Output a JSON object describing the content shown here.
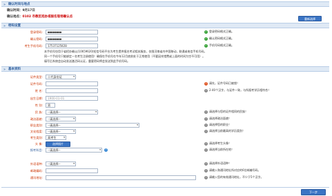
{
  "sections": {
    "confirm": "确认时间与地点",
    "password": "密码设置",
    "basic": "基本资料"
  },
  "confirm": {
    "time_label": "确认时间：",
    "time_value": "9月17日",
    "place_label": "确认地点：",
    "place_value": "0102  市教区招办或报名现场确认点",
    "reselect": "重新选择"
  },
  "password": {
    "login_label": "登录密码:",
    "login_value": "●●●●●●●●",
    "login_hint": "登录密码格式正确。",
    "confirm_label": "确认密码:",
    "confirm_value": "●●●●●●●●",
    "confirm_hint": "确认密码格式正确。",
    "phone_label": "考生手机号码:",
    "phone_value": "17537125820",
    "phone_hint": "手机号码格式正确。",
    "notice": [
      "本手机号仅用于省招办确认(10659620)短信号码平台为考生提供报名考试相关服务，仅限河南省内中国移动，联通或电信手机号码。",
      "同一个手机号只能绑定一名考生注册使用！确保在手机号在今年12月底前处于正常使用（不要因充错费或上面的时间为空不可用）。",
      "填写后系统会自动发送激活码认证，重要密码将会发送到此手机号码。"
    ]
  },
  "basic": {
    "id_type_label": "证件类型:",
    "id_type_value": "二代身份证",
    "id_no_label": "证件号码:",
    "id_no_value": "",
    "id_no_hint": "请先，证件号码已被锁！",
    "name_label": "姓    名:",
    "name_value": "",
    "name_hint": "2-40个汉字，与证件一致，与所报考学历相符合！",
    "birth_label": "出生日期:",
    "birth_value": "1900-01-01",
    "gender_label": "性    别:",
    "gender_value": "男",
    "ethnic_label": "民    族:",
    "ethnic_value": "--请选择--",
    "ethnic_hint": "请选择与您的证件相同的民族！",
    "politic_label": "政治面貌:",
    "politic_value": "--请选择--",
    "politic_hint": "请选择政治面貌！",
    "job_label": "职业类别:",
    "job_value": "--请选择--",
    "job_hint": "请选择您的职业！",
    "edu_label": "文化程度:",
    "edu_value": "--请选择--",
    "edu_hint": "请选择当前最高的学历类别！",
    "student_type_label": "考生类别:",
    "student_type_value": "高考生",
    "photo_label": "头    像:",
    "photo_button": "选择照片",
    "photo_hint": "请选择考生头像！",
    "checkin_label": "报考科目:",
    "checkin_value": "--请选择--",
    "checkin_hint": "请选择当前所在地！",
    "lang_label": "外语语种:",
    "lang_value": "--请选择--",
    "lang_hint": "请选择外语语种！",
    "postcode_label": "邮政编码:",
    "postcode_value": "",
    "postcode_hint": "请输入和通讯地址所对应的6位邮编号码。",
    "address_label": "通讯地址:",
    "address_value": "",
    "address_hint": "请输入您的有效通讯地址，不少于5个汉字。"
  },
  "next_button": "下一步",
  "colors": {
    "header_bg": "#dfe9f5",
    "accent": "#3a74c4",
    "label_red": "#cc3300",
    "ok": "#3aa33a"
  }
}
